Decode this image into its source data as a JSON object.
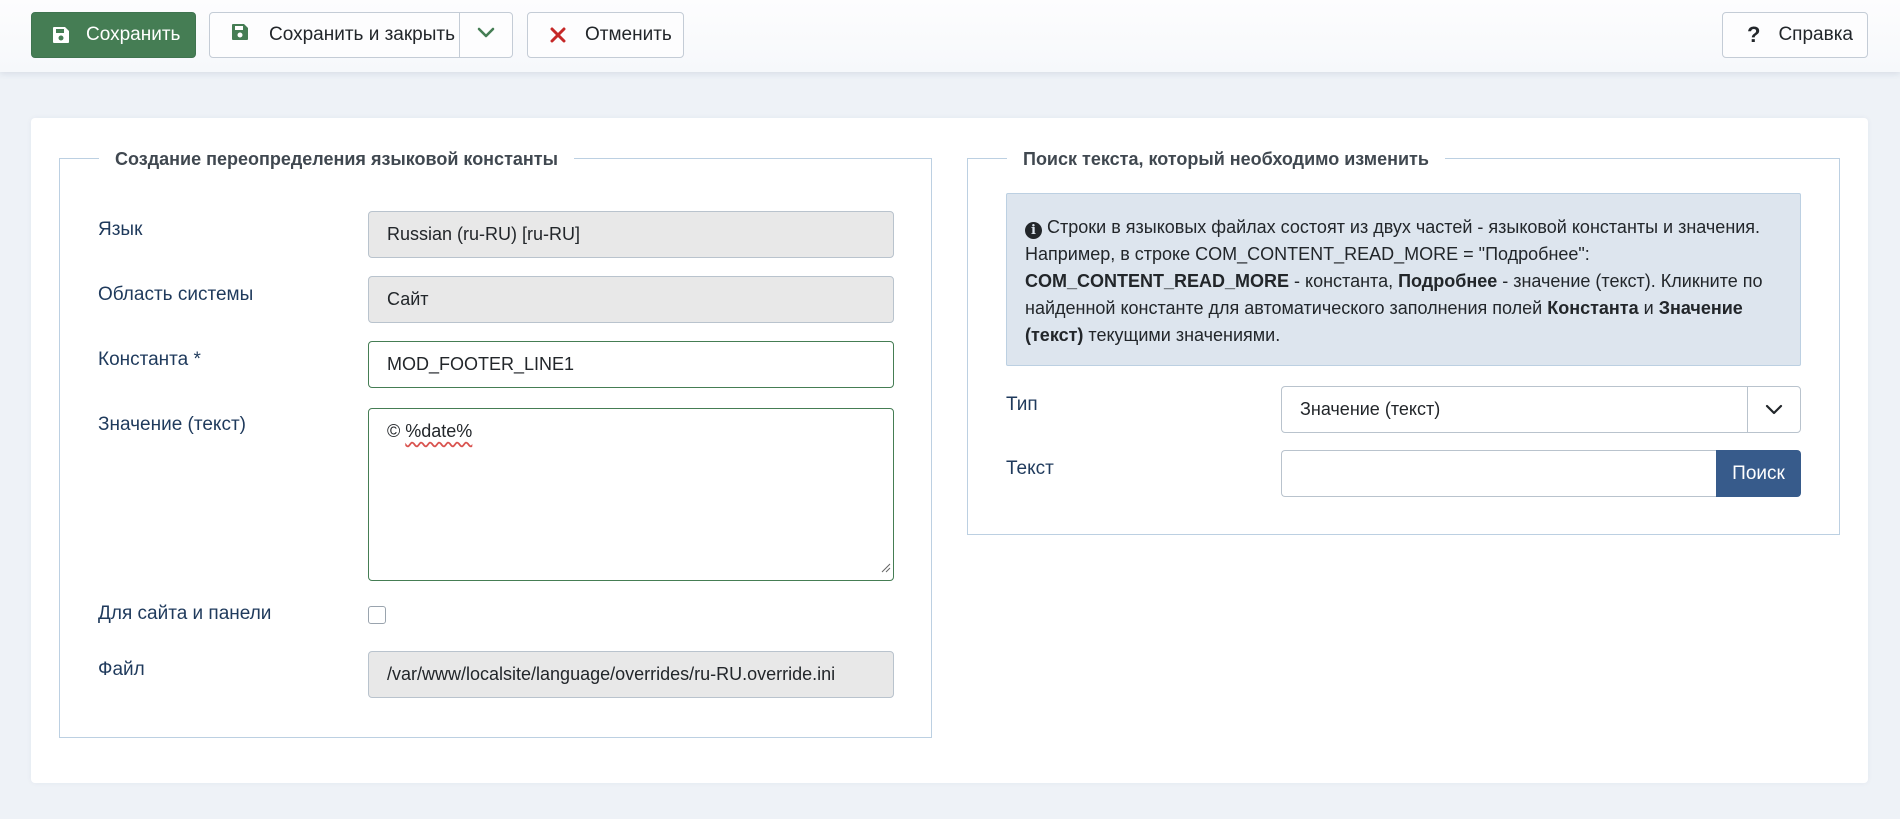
{
  "toolbar": {
    "save_label": "Сохранить",
    "save_close_label": "Сохранить и закрыть",
    "cancel_label": "Отменить",
    "help_label": "Справка"
  },
  "override_form": {
    "legend": "Создание переопределения языковой константы",
    "language_label": "Язык",
    "language_value": "Russian (ru-RU) [ru-RU]",
    "client_label": "Область системы",
    "client_value": "Сайт",
    "constant_label": "Константа *",
    "constant_value": "MOD_FOOTER_LINE1",
    "text_label": "Значение (текст)",
    "text_value_prefix": "© ",
    "text_value_token": "%date%",
    "both_label": "Для сайта и панели",
    "both_checked": false,
    "file_label": "Файл",
    "file_value": "/var/www/localsite/language/overrides/ru-RU.override.ini"
  },
  "search_panel": {
    "legend": "Поиск текста, который необходимо изменить",
    "info": {
      "line1": "Строки в языковых файлах состоят из двух частей - языковой константы и значения.",
      "line2": "Например, в строке COM_CONTENT_READ_MORE = \"Подробнее\":",
      "const_bold": "COM_CONTENT_READ_MORE",
      "const_suffix": " - константа, ",
      "value_bold": "Подробнее",
      "value_suffix": " - значение (текст). Кликните по",
      "line4_prefix": "найденной константе для автоматического заполнения полей ",
      "field1_bold": "Константа",
      "and": " и ",
      "field2_bold_a": "Значение",
      "field2_bold_b": "(текст)",
      "tail": " текущими значениями."
    },
    "type_label": "Тип",
    "type_value": "Значение (текст)",
    "text_label": "Текст",
    "text_value": "",
    "search_button": "Поиск"
  },
  "colors": {
    "save_button": "#457d54",
    "search_button": "#375b8b",
    "cancel_icon": "#c52827",
    "info_bg": "#dde5ee",
    "valid_border": "#457d54"
  }
}
